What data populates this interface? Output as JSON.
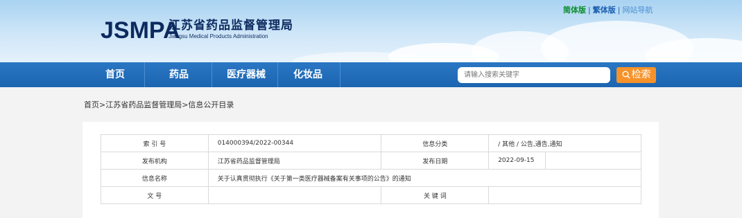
{
  "header": {
    "logo": "JSMPA",
    "org_name_cn": "江苏省药品监督管理局",
    "org_name_en": "Jiangsu Medical Products Administration",
    "links": {
      "simplified": "简体版",
      "traditional": "繁体版",
      "sitemap": "网站导航"
    }
  },
  "nav": {
    "items": [
      "首页",
      "药品",
      "医疗器械",
      "化妆品"
    ],
    "search_placeholder": "请输入搜索关键字",
    "search_button": "检索"
  },
  "breadcrumb": "首页>江苏省药品监督管理局>信息公开目录",
  "info_table": {
    "index_label": "索 引 号",
    "index_value": "014000394/2022-00344",
    "category_label": "信息分类",
    "category_value": "/ 其他 / 公告,通告,通知",
    "org_label": "发布机构",
    "org_value": "江苏省药品监督管理局",
    "date_label": "发布日期",
    "date_value": "2022-09-15",
    "name_label": "信息名称",
    "name_value": "关于认真贯彻执行《关于第一类医疗器械备案有关事项的公告》的通知",
    "docno_label": "文 号",
    "docno_value": "",
    "keywords_label": "关 键 词",
    "keywords_value": ""
  },
  "colors": {
    "nav_bg": "#1b64b0",
    "search_button": "#f6922a",
    "simplified_link": "#0a8d2c"
  }
}
